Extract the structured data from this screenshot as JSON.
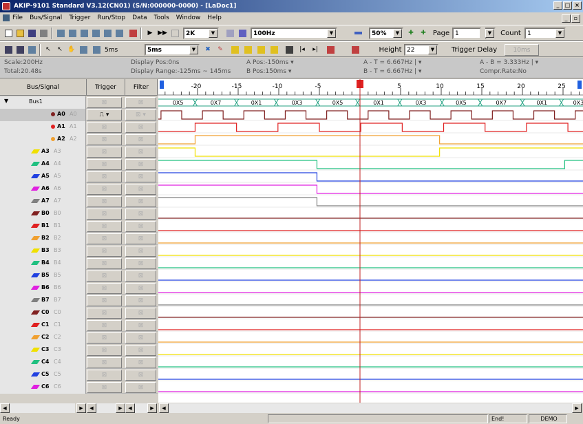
{
  "window": {
    "title": "AKIP-9101 Standard V3.12(CN01) (S/N:000000-0000) - [LaDoc1]"
  },
  "menu": [
    "File",
    "Bus/Signal",
    "Trigger",
    "Run/Stop",
    "Data",
    "Tools",
    "Window",
    "Help"
  ],
  "toolbar": {
    "sample_rate": "2K",
    "frequency": "100Hz",
    "zoom": "50%",
    "page_label": "Page",
    "page_value": "1",
    "count_label": "Count",
    "count_value": "1",
    "time_per_div": "5ms",
    "height_label": "Height",
    "height_value": "22",
    "trigger_delay_label": "Trigger Delay",
    "trigger_delay_value": "10ms"
  },
  "info": {
    "scale": "Scale:200Hz",
    "total": "Total:20.48s",
    "display_pos": "Display Pos:0ns",
    "display_range": "Display Range:-125ms ~ 145ms",
    "a_pos": "A Pos:-150ms",
    "b_pos": "B Pos:150ms",
    "a_t": "A - T = 6.667Hz",
    "b_t": "B - T = 6.667Hz",
    "a_b": "A - B = 3.333Hz",
    "compr": "Compr.Rate:No"
  },
  "columns": {
    "signal": "Bus/Signal",
    "trigger": "Trigger",
    "filter": "Filter"
  },
  "ruler": [
    {
      "label": "-20",
      "t": -20
    },
    {
      "label": "-15",
      "t": -15
    },
    {
      "label": "-10",
      "t": -10
    },
    {
      "label": "-5",
      "t": -5
    },
    {
      "label": "0",
      "t": 0
    },
    {
      "label": "5",
      "t": 5
    },
    {
      "label": "10",
      "t": 10
    },
    {
      "label": "15",
      "t": 15
    },
    {
      "label": "20",
      "t": 20
    },
    {
      "label": "25",
      "t": 25
    }
  ],
  "bus": {
    "name": "Bus1",
    "values": [
      "0X5",
      "0X7",
      "0X1",
      "0X3",
      "0X5",
      "0X1",
      "0X3",
      "0X5",
      "0X7",
      "0X1",
      "0X3",
      "0X5",
      "0X7"
    ]
  },
  "signals": [
    {
      "name": "A0",
      "alias": "A0",
      "color": "#802020",
      "marker": "dot"
    },
    {
      "name": "A1",
      "alias": "A1",
      "color": "#e02020",
      "marker": "dot"
    },
    {
      "name": "A2",
      "alias": "A2",
      "color": "#f0a030",
      "marker": "dot"
    },
    {
      "name": "A3",
      "alias": "A3",
      "color": "#f0e000",
      "marker": "pen"
    },
    {
      "name": "A4",
      "alias": "A4",
      "color": "#20c080",
      "marker": "pen"
    },
    {
      "name": "A5",
      "alias": "A5",
      "color": "#2040e0",
      "marker": "pen"
    },
    {
      "name": "A6",
      "alias": "A6",
      "color": "#e020e0",
      "marker": "pen"
    },
    {
      "name": "A7",
      "alias": "A7",
      "color": "#808080",
      "marker": "pen"
    },
    {
      "name": "B0",
      "alias": "B0",
      "color": "#802020",
      "marker": "pen"
    },
    {
      "name": "B1",
      "alias": "B1",
      "color": "#e02020",
      "marker": "pen"
    },
    {
      "name": "B2",
      "alias": "B2",
      "color": "#f0a030",
      "marker": "pen"
    },
    {
      "name": "B3",
      "alias": "B3",
      "color": "#f0e000",
      "marker": "pen"
    },
    {
      "name": "B4",
      "alias": "B4",
      "color": "#20c080",
      "marker": "pen"
    },
    {
      "name": "B5",
      "alias": "B5",
      "color": "#2040e0",
      "marker": "pen"
    },
    {
      "name": "B6",
      "alias": "B6",
      "color": "#e020e0",
      "marker": "pen"
    },
    {
      "name": "B7",
      "alias": "B7",
      "color": "#808080",
      "marker": "pen"
    },
    {
      "name": "C0",
      "alias": "C0",
      "color": "#802020",
      "marker": "pen"
    },
    {
      "name": "C1",
      "alias": "C1",
      "color": "#e02020",
      "marker": "pen"
    },
    {
      "name": "C2",
      "alias": "C2",
      "color": "#f0a030",
      "marker": "pen"
    },
    {
      "name": "C3",
      "alias": "C3",
      "color": "#f0e000",
      "marker": "pen"
    },
    {
      "name": "C4",
      "alias": "C4",
      "color": "#20c080",
      "marker": "pen"
    },
    {
      "name": "C5",
      "alias": "C5",
      "color": "#2040e0",
      "marker": "pen"
    },
    {
      "name": "C6",
      "alias": "C6",
      "color": "#e020e0",
      "marker": "pen"
    }
  ],
  "status": {
    "ready": "Ready",
    "end": "End!",
    "demo": "DEMO"
  }
}
